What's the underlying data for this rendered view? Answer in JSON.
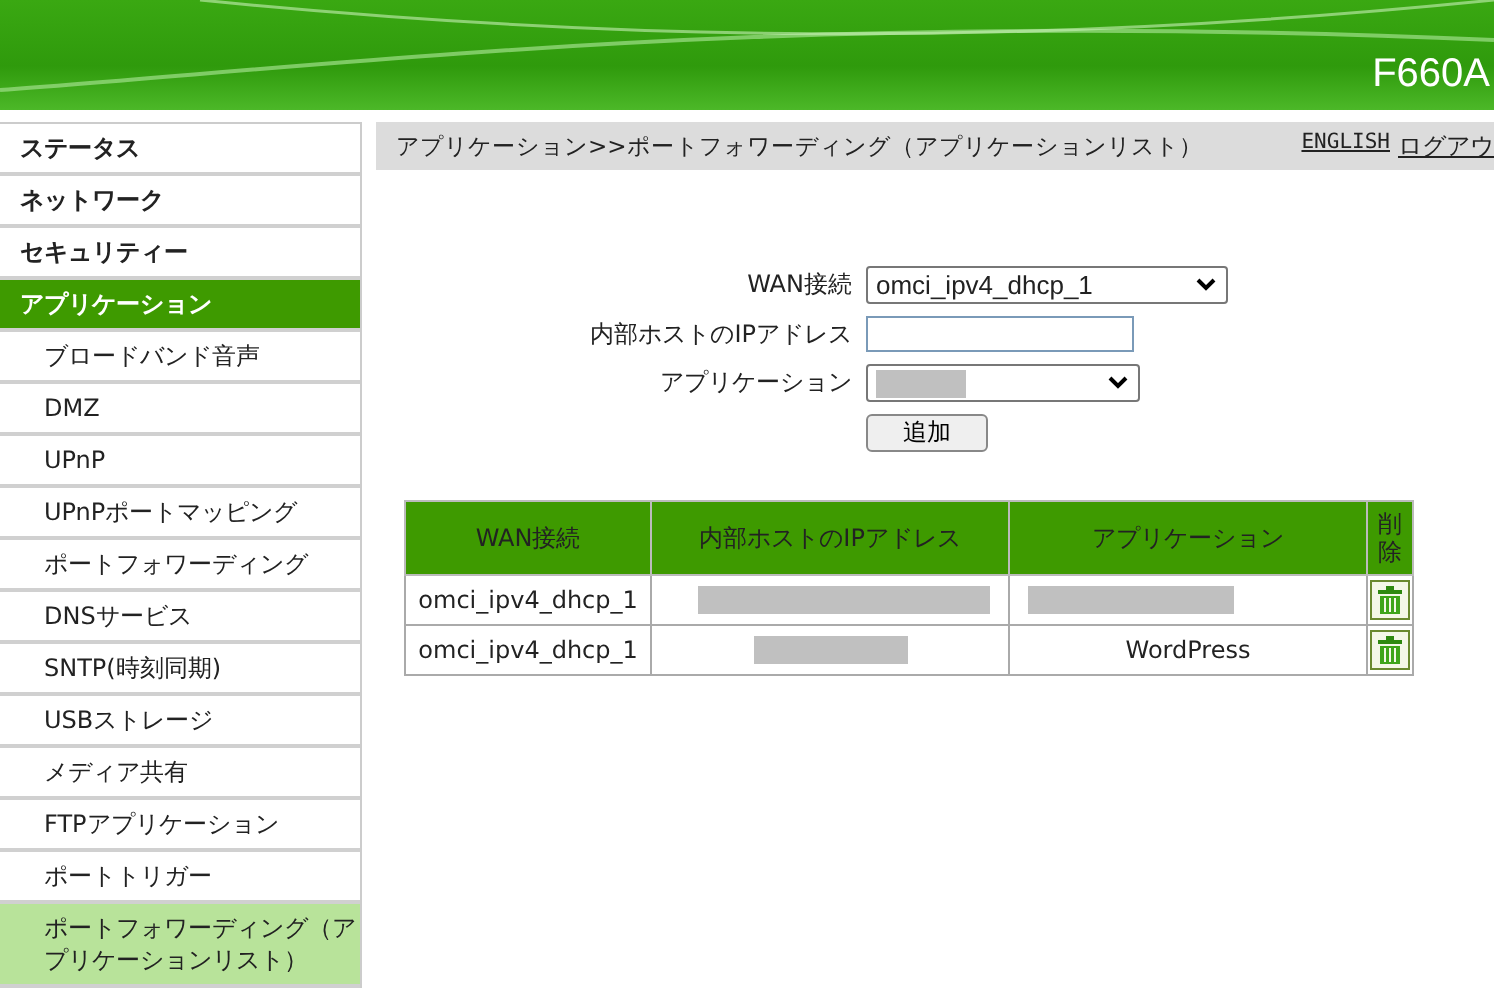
{
  "header": {
    "model": "F660A"
  },
  "sidebar": {
    "items": [
      {
        "label": "ステータス",
        "selected": false
      },
      {
        "label": "ネットワーク",
        "selected": false
      },
      {
        "label": "セキュリティー",
        "selected": false
      },
      {
        "label": "アプリケーション",
        "selected": true,
        "children": [
          {
            "label": "ブロードバンド音声",
            "selected": false
          },
          {
            "label": "DMZ",
            "selected": false
          },
          {
            "label": "UPnP",
            "selected": false
          },
          {
            "label": "UPnPポートマッピング",
            "selected": false
          },
          {
            "label": "ポートフォワーディング",
            "selected": false
          },
          {
            "label": "DNSサービス",
            "selected": false
          },
          {
            "label": "SNTP(時刻同期)",
            "selected": false
          },
          {
            "label": "USBストレージ",
            "selected": false
          },
          {
            "label": "メディア共有",
            "selected": false
          },
          {
            "label": "FTPアプリケーション",
            "selected": false
          },
          {
            "label": "ポートトリガー",
            "selected": false
          },
          {
            "label": "ポートフォワーディング（アプリケーションリスト）",
            "selected": true
          }
        ]
      }
    ]
  },
  "breadcrumb": "アプリケーション>>ポートフォワーディング（アプリケーションリスト）",
  "links": [
    "ENGLISH",
    "ログアウ"
  ],
  "form": {
    "fields": [
      {
        "kind": "select",
        "label": "WAN接続",
        "value": "omci_ipv4_dhcp_1"
      },
      {
        "kind": "input",
        "label": "内部ホストのIPアドレス"
      },
      {
        "kind": "select",
        "label": "アプリケーション",
        "redacted": true
      }
    ],
    "button": "追加"
  },
  "table": {
    "columns": [
      "WAN接続",
      "内部ホストのIPアドレス",
      "アプリケーション",
      "削除"
    ],
    "rows": [
      {
        "cells": [
          {
            "text": "omci_ipv4_dhcp_1"
          },
          {
            "redacted": true
          },
          {
            "redacted": true
          }
        ]
      },
      {
        "cells": [
          {
            "text": "omci_ipv4_dhcp_1"
          },
          {
            "redacted": true
          },
          {
            "text": "WordPress"
          }
        ]
      }
    ]
  }
}
